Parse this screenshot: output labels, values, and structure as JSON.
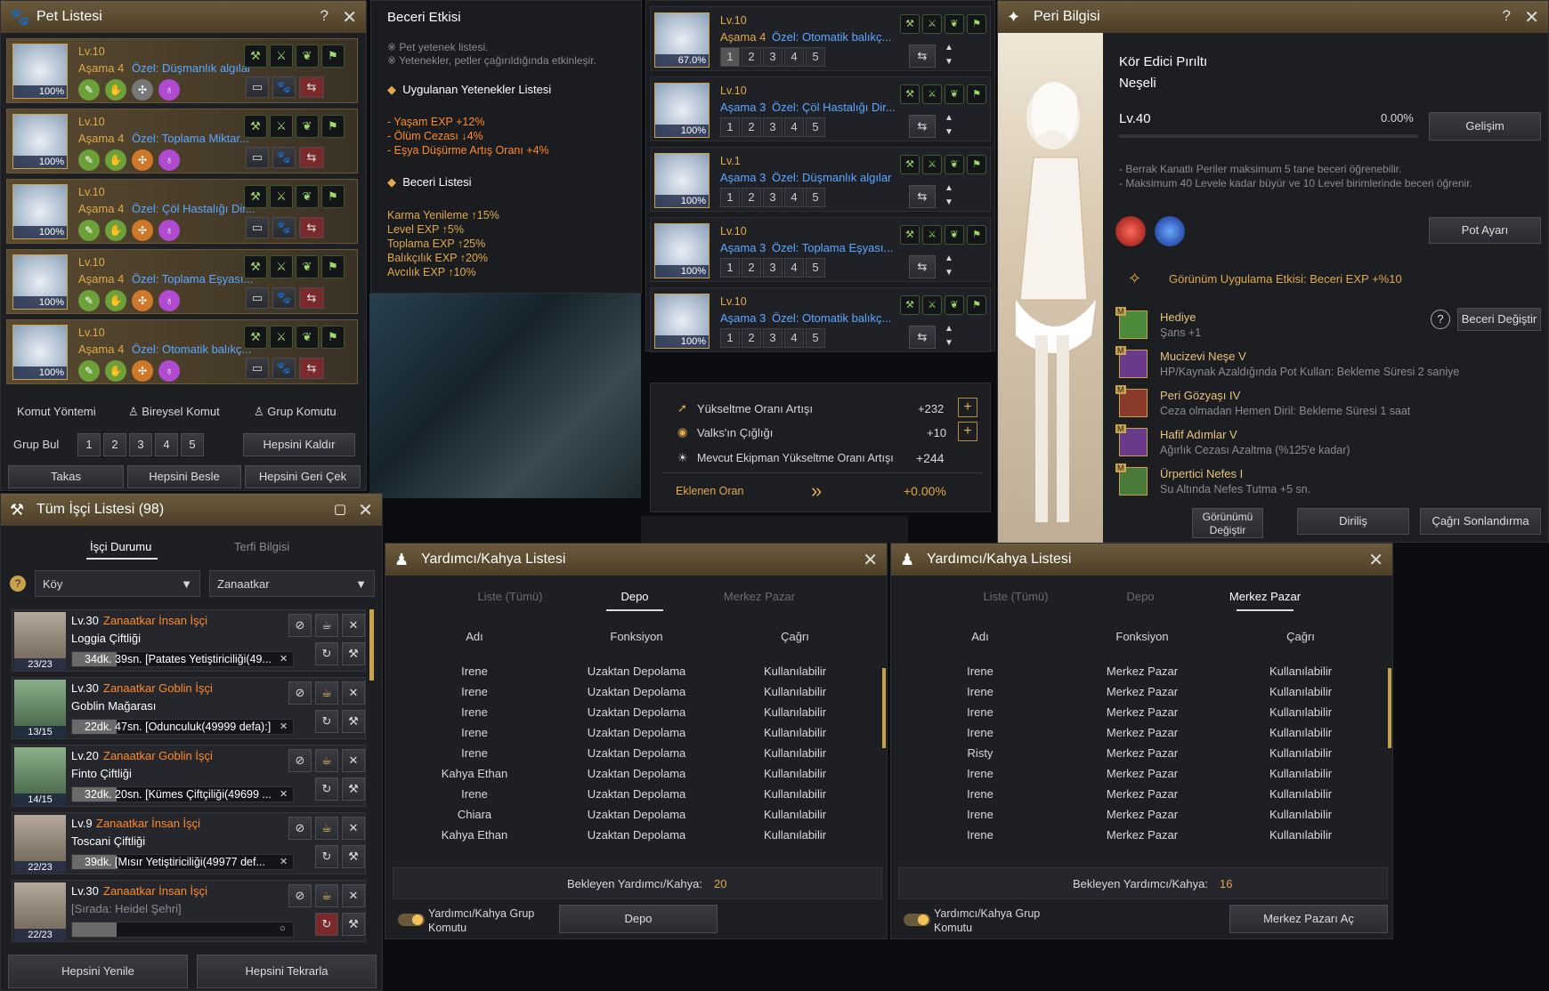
{
  "pet_list": {
    "title": "Pet Listesi",
    "pets": [
      {
        "level": "Lv.10",
        "stage": "Aşama 4",
        "special": "Özel: Düşmanlık algılar",
        "pct": "100%"
      },
      {
        "level": "Lv.10",
        "stage": "Aşama 4",
        "special": "Özel: Toplama Miktar...",
        "pct": "100%"
      },
      {
        "level": "Lv.10",
        "stage": "Aşama 4",
        "special": "Özel: Çöl Hastalığı Dir...",
        "pct": "100%"
      },
      {
        "level": "Lv.10",
        "stage": "Aşama 4",
        "special": "Özel: Toplama Eşyası...",
        "pct": "100%"
      },
      {
        "level": "Lv.10",
        "stage": "Aşama 4",
        "special": "Özel: Otomatik balıkç...",
        "pct": "100%"
      }
    ],
    "command_method": "Komut Yöntemi",
    "individual_command": "Bireysel Komut",
    "group_command": "Grup Komutu",
    "group_find": "Grup Bul",
    "group_nums": [
      "1",
      "2",
      "3",
      "4",
      "5"
    ],
    "remove_all": "Hepsini Kaldır",
    "trade": "Takas",
    "feed_all": "Hepsini Besle",
    "recall_all": "Hepsini Geri Çek"
  },
  "skill_effect": {
    "title": "Beceri Etkisi",
    "note1": "※ Pet yetenek listesi.",
    "note2": "※ Yetenekler, petler çağırıldığında etkinleşir.",
    "applied_header": "Uygulanan Yetenekler Listesi",
    "applied": [
      "- Yaşam EXP +12%",
      "- Ölüm Cezası ↓4%",
      "- Eşya Düşürme Artış Oranı +4%"
    ],
    "skill_header": "Beceri Listesi",
    "skills": [
      "Karma Yenileme ↑15%",
      "Level EXP ↑5%",
      "Toplama EXP ↑25%",
      "Balıkçılık EXP ↑20%",
      "Avcılık EXP ↑10%"
    ]
  },
  "pet_list2": {
    "pets": [
      {
        "level": "Lv.10",
        "stage": "Aşama 4",
        "special": "Özel: Otomatik balıkç...",
        "pct": "67.0%"
      },
      {
        "level": "Lv.10",
        "stage": "Aşama 3",
        "special": "Özel: Çöl Hastalığı Dir...",
        "pct": "100%"
      },
      {
        "level": "Lv.1",
        "stage": "Aşama 3",
        "special": "Özel: Düşmanlık algılar",
        "pct": "100%"
      },
      {
        "level": "Lv.10",
        "stage": "Aşama 3",
        "special": "Özel: Toplama Eşyası...",
        "pct": "100%"
      },
      {
        "level": "Lv.10",
        "stage": "Aşama 3",
        "special": "Özel: Otomatik balıkç...",
        "pct": "100%"
      }
    ],
    "nums": [
      "1",
      "2",
      "3",
      "4",
      "5"
    ]
  },
  "upgrade": {
    "rate_inc": "Yükseltme Oranı Artışı",
    "rate_val": "+232",
    "valks": "Valks'ın Çığlığı",
    "valks_val": "+10",
    "current": "Mevcut Ekipman Yükseltme Oranı Artışı",
    "current_val": "+244",
    "added": "Eklenen Oran",
    "added_val": "+0.00%"
  },
  "fairy": {
    "title": "Peri Bilgisi",
    "name": "Kör Edici Pırıltı",
    "mood": "Neşeli",
    "level": "Lv.40",
    "exp": "0.00%",
    "develop": "Gelişim",
    "info1": "- Berrak Kanatlı Periler maksimum 5 tane beceri öğrenebilir.",
    "info2": "- Maksimum 40 Levele kadar büyür ve 10 Level birimlerinde beceri öğrenir.",
    "pot_setting": "Pot Ayarı",
    "appearance_effect": "Görünüm Uygulama Etkisi: Beceri EXP +%10",
    "change_skill": "Beceri Değiştir",
    "skills": [
      {
        "name": "Hediye",
        "desc": "Şans +1"
      },
      {
        "name": "Mucizevi Neşe V",
        "desc": "HP/Kaynak Azaldığında Pot Kullan: Bekleme Süresi 2 saniye"
      },
      {
        "name": "Peri Gözyaşı IV",
        "desc": "Ceza olmadan Hemen Diril: Bekleme Süresi 1 saat"
      },
      {
        "name": "Hafif Adımlar V",
        "desc": "Ağırlık Cezası Azaltma (%125'e kadar)"
      },
      {
        "name": "Ürpertici Nefes I",
        "desc": "Su Altında Nefes Tutma +5 sn."
      }
    ],
    "change_look": "Görünümü Değiştir",
    "revive": "Diriliş",
    "end_call": "Çağrı Sonlandırma"
  },
  "workers": {
    "title": "Tüm İşçi Listesi (98)",
    "tab1": "İşçi Durumu",
    "tab2": "Terfi Bilgisi",
    "filter1": "Köy",
    "filter2": "Zanaatkar",
    "list": [
      {
        "level": "Lv.30",
        "type": "Zanaatkar İnsan İşçi",
        "place": "Loggia Çiftliği",
        "stamina": "23/23",
        "task": "34dk. 39sn. [Patates Yetiştiriciliği(49..."
      },
      {
        "level": "Lv.30",
        "type": "Zanaatkar Goblin İşçi",
        "place": "Goblin Mağarası",
        "stamina": "13/15",
        "task": "22dk. 47sn. [Odunculuk(49999 defa):]"
      },
      {
        "level": "Lv.20",
        "type": "Zanaatkar Goblin İşçi",
        "place": "Finto Çiftliği",
        "stamina": "14/15",
        "task": "32dk. 20sn. [Kümes Çiftçiliği(49699 ..."
      },
      {
        "level": "Lv.9",
        "type": "Zanaatkar İnsan İşçi",
        "place": "Toscani Çiftliği",
        "stamina": "22/23",
        "task": "39dk. [Mısır Yetiştiriciliği(49977 def..."
      },
      {
        "level": "Lv.30",
        "type": "Zanaatkar İnsan İşçi",
        "place": "[Sırada: Heidel Şehri]",
        "stamina": "22/23",
        "task": ""
      }
    ],
    "refresh_all": "Hepsini Yenile",
    "repeat_all": "Hepsini Tekrarla"
  },
  "helper1": {
    "title": "Yardımcı/Kahya Listesi",
    "tabs": [
      "Liste (Tümü)",
      "Depo",
      "Merkez Pazar"
    ],
    "active_tab": 1,
    "cols": [
      "Adı",
      "Fonksiyon",
      "Çağrı"
    ],
    "rows": [
      [
        "Irene",
        "Uzaktan Depolama",
        "Kullanılabilir"
      ],
      [
        "Irene",
        "Uzaktan Depolama",
        "Kullanılabilir"
      ],
      [
        "Irene",
        "Uzaktan Depolama",
        "Kullanılabilir"
      ],
      [
        "Irene",
        "Uzaktan Depolama",
        "Kullanılabilir"
      ],
      [
        "Irene",
        "Uzaktan Depolama",
        "Kullanılabilir"
      ],
      [
        "Kahya Ethan",
        "Uzaktan Depolama",
        "Kullanılabilir"
      ],
      [
        "Irene",
        "Uzaktan Depolama",
        "Kullanılabilir"
      ],
      [
        "Chiara",
        "Uzaktan Depolama",
        "Kullanılabilir"
      ],
      [
        "Kahya Ethan",
        "Uzaktan Depolama",
        "Kullanılabilir"
      ]
    ],
    "waiting": "Bekleyen Yardımcı/Kahya:",
    "waiting_val": "20",
    "group_cmd": "Yardımcı/Kahya Grup Komutu",
    "action": "Depo"
  },
  "helper2": {
    "title": "Yardımcı/Kahya Listesi",
    "tabs": [
      "Liste (Tümü)",
      "Depo",
      "Merkez Pazar"
    ],
    "active_tab": 2,
    "cols": [
      "Adı",
      "Fonksiyon",
      "Çağrı"
    ],
    "rows": [
      [
        "Irene",
        "Merkez Pazar",
        "Kullanılabilir"
      ],
      [
        "Irene",
        "Merkez Pazar",
        "Kullanılabilir"
      ],
      [
        "Irene",
        "Merkez Pazar",
        "Kullanılabilir"
      ],
      [
        "Irene",
        "Merkez Pazar",
        "Kullanılabilir"
      ],
      [
        "Risty",
        "Merkez Pazar",
        "Kullanılabilir"
      ],
      [
        "Irene",
        "Merkez Pazar",
        "Kullanılabilir"
      ],
      [
        "Irene",
        "Merkez Pazar",
        "Kullanılabilir"
      ],
      [
        "Irene",
        "Merkez Pazar",
        "Kullanılabilir"
      ],
      [
        "Irene",
        "Merkez Pazar",
        "Kullanılabilir"
      ]
    ],
    "waiting": "Bekleyen Yardımcı/Kahya:",
    "waiting_val": "16",
    "group_cmd": "Yardımcı/Kahya Grup Komutu",
    "action": "Merkez Pazarı Aç"
  }
}
